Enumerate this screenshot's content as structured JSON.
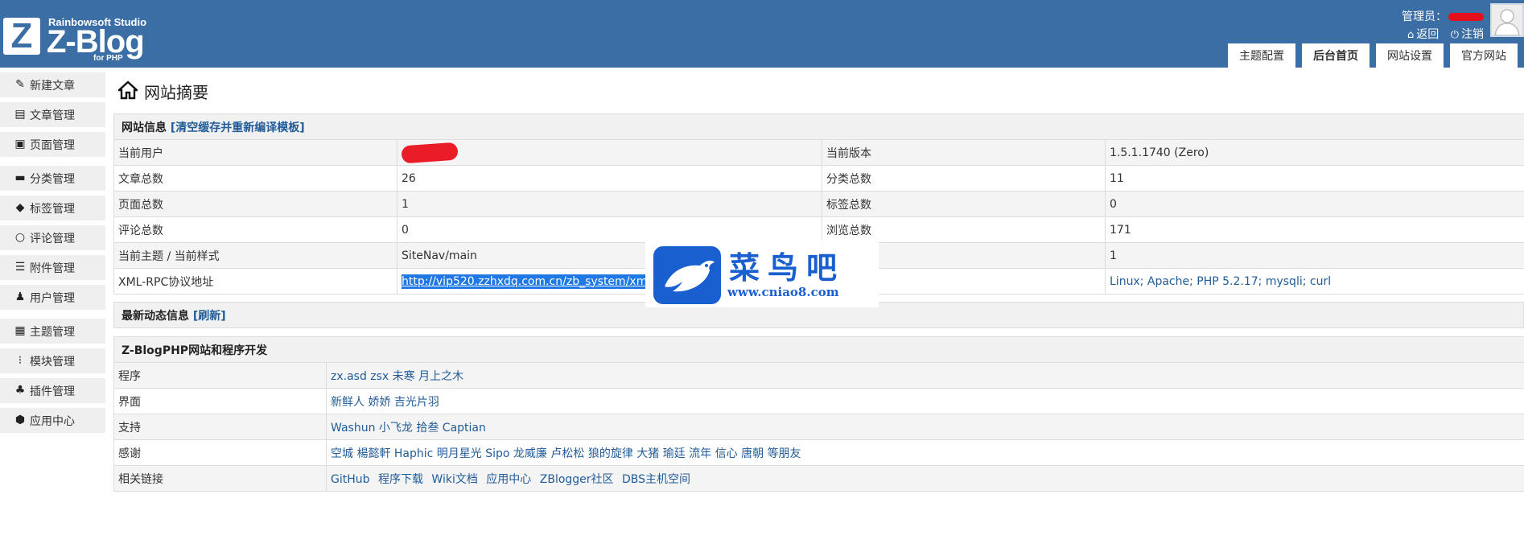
{
  "colors": {
    "header_bg": "#3a6ea5",
    "sidebar_bg": "#efefef",
    "link": "#215c99",
    "redaction": "#e4101c",
    "selection": "#1f78e4",
    "watermark": "#1a5fd0"
  },
  "header": {
    "logo": {
      "studio": "Rainbowsoft Studio",
      "brand": "Z-Blog",
      "mark": "Z",
      "sub": "for PHP"
    },
    "admin_label": "管理员：",
    "return_label": "返回",
    "logout_label": "注销",
    "tabs": [
      {
        "label": "主题配置"
      },
      {
        "label": "后台首页",
        "active": true
      },
      {
        "label": "网站设置"
      },
      {
        "label": "官方网站"
      }
    ]
  },
  "sidebar": {
    "items": [
      {
        "label": "新建文章",
        "icon": "edit-icon"
      },
      {
        "label": "文章管理",
        "icon": "document-icon"
      },
      {
        "label": "页面管理",
        "icon": "page-icon"
      },
      {
        "label": "分类管理",
        "icon": "folder-icon"
      },
      {
        "label": "标签管理",
        "icon": "tag-icon"
      },
      {
        "label": "评论管理",
        "icon": "comment-icon"
      },
      {
        "label": "附件管理",
        "icon": "attachment-icon"
      },
      {
        "label": "用户管理",
        "icon": "user-icon"
      },
      {
        "label": "主题管理",
        "icon": "theme-icon"
      },
      {
        "label": "模块管理",
        "icon": "module-icon"
      },
      {
        "label": "插件管理",
        "icon": "plugin-icon"
      },
      {
        "label": "应用中心",
        "icon": "app-center-icon"
      }
    ]
  },
  "main": {
    "title": "网站摘要",
    "site_info": {
      "header_label": "网站信息",
      "header_link": "[清空缓存并重新编译模板]",
      "rows": [
        {
          "l1": "当前用户",
          "v1": "",
          "l2": "当前版本",
          "v2": "1.5.1.1740 (Zero)"
        },
        {
          "l1": "文章总数",
          "v1": "26",
          "l2": "分类总数",
          "v2": "11"
        },
        {
          "l1": "页面总数",
          "v1": "1",
          "l2": "标签总数",
          "v2": "0"
        },
        {
          "l1": "评论总数",
          "v1": "0",
          "l2": "浏览总数",
          "v2": "171"
        },
        {
          "l1": "当前主题 / 当前样式",
          "v1": "SiteNav/main",
          "l2": "",
          "v2": "1"
        },
        {
          "l1": "XML-RPC协议地址",
          "v1": "http://vip520.zzhxdq.com.cn/zb_system/xml-r",
          "l2": "",
          "v2": "Linux; Apache; PHP 5.2.17; mysqli; curl"
        }
      ]
    },
    "news": {
      "header_label": "最新动态信息",
      "header_link": "[刷新]"
    },
    "dev": {
      "header_label": "Z-BlogPHP网站和程序开发",
      "rows": [
        {
          "label": "程序",
          "value": "zx.asd zsx 未寒 月上之木"
        },
        {
          "label": "界面",
          "value": "新鲜人 娇娇 吉光片羽"
        },
        {
          "label": "支持",
          "value": "Washun 小飞龙 拾叁 Captian"
        },
        {
          "label": "感谢",
          "value": "空城 楊懿軒 Haphic 明月星光 Sipo 龙威廉 卢松松 狼的旋律 大猪 瑜廷 流年 信心 唐朝 等朋友"
        }
      ],
      "links_label": "相关链接",
      "links": [
        "GitHub",
        "程序下载",
        "Wiki文档",
        "应用中心",
        "ZBlogger社区",
        "DBS主机空间"
      ]
    }
  },
  "watermark": {
    "cn": "菜鸟吧",
    "url": "www.cniao8.com"
  }
}
